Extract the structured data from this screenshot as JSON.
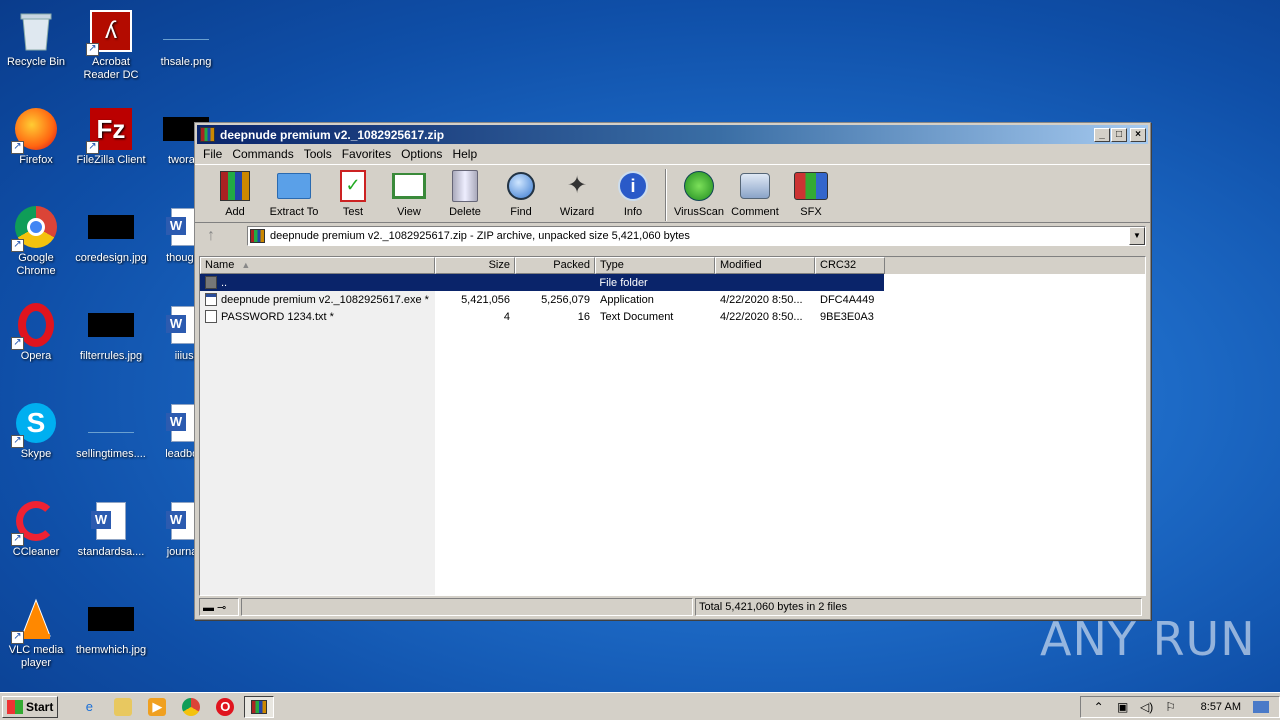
{
  "desktop": {
    "icons": [
      {
        "label": "Recycle Bin"
      },
      {
        "label": "Acrobat Reader DC"
      },
      {
        "label": "thsale.png"
      },
      {
        "label": "Firefox"
      },
      {
        "label": "FileZilla Client"
      },
      {
        "label": "tworate"
      },
      {
        "label": "Google Chrome"
      },
      {
        "label": "coredesign.jpg"
      },
      {
        "label": "thoughtf"
      },
      {
        "label": "Opera"
      },
      {
        "label": "filterrules.jpg"
      },
      {
        "label": "iiiusr"
      },
      {
        "label": "Skype"
      },
      {
        "label": "sellingtimes...."
      },
      {
        "label": "leadbost"
      },
      {
        "label": "CCleaner"
      },
      {
        "label": "standardsa...."
      },
      {
        "label": "journalc"
      },
      {
        "label": "VLC media player"
      },
      {
        "label": "themwhich.jpg"
      }
    ],
    "watermark": "ANY RUN"
  },
  "window": {
    "title": "deepnude premium v2._1082925617.zip",
    "controls": {
      "minimize": "_",
      "maximize": "□",
      "close": "×"
    },
    "menu": [
      "File",
      "Commands",
      "Tools",
      "Favorites",
      "Options",
      "Help"
    ],
    "toolbar": [
      {
        "label": "Add",
        "icon": "add-archive-icon"
      },
      {
        "label": "Extract To",
        "icon": "extract-folder-icon"
      },
      {
        "label": "Test",
        "icon": "test-checklist-icon"
      },
      {
        "label": "View",
        "icon": "view-book-icon"
      },
      {
        "label": "Delete",
        "icon": "trash-icon"
      },
      {
        "label": "Find",
        "icon": "magnifier-icon"
      },
      {
        "label": "Wizard",
        "icon": "wand-icon"
      },
      {
        "label": "Info",
        "icon": "info-icon"
      },
      {
        "label": "VirusScan",
        "icon": "bug-icon"
      },
      {
        "label": "Comment",
        "icon": "comment-icon"
      },
      {
        "label": "SFX",
        "icon": "sfx-icon"
      }
    ],
    "address": "deepnude premium v2._1082925617.zip - ZIP archive, unpacked size 5,421,060 bytes",
    "columns": [
      "Name",
      "Size",
      "Packed",
      "Type",
      "Modified",
      "CRC32"
    ],
    "rows": [
      {
        "name": "..",
        "size": "",
        "packed": "",
        "type": "File folder",
        "modified": "",
        "crc": "",
        "icon": "folder",
        "selected": true
      },
      {
        "name": "deepnude premium v2._1082925617.exe *",
        "size": "5,421,056",
        "packed": "5,256,079",
        "type": "Application",
        "modified": "4/22/2020 8:50...",
        "crc": "DFC4A449",
        "icon": "exe",
        "selected": false
      },
      {
        "name": "PASSWORD 1234.txt *",
        "size": "4",
        "packed": "16",
        "type": "Text Document",
        "modified": "4/22/2020 8:50...",
        "crc": "9BE3E0A3",
        "icon": "txt",
        "selected": false
      }
    ],
    "status": "Total 5,421,060 bytes in 2 files"
  },
  "taskbar": {
    "start": "Start",
    "clock": "8:57 AM"
  }
}
